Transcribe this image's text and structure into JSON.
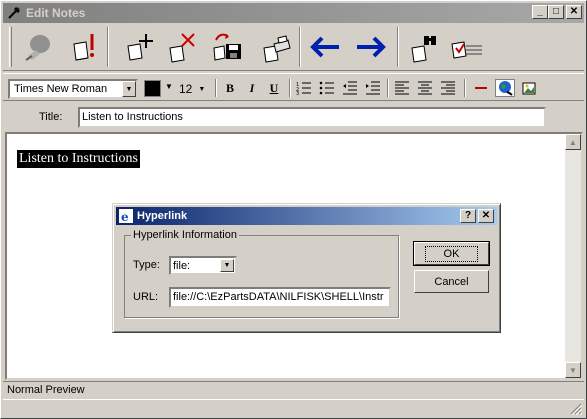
{
  "window": {
    "title": "Edit Notes"
  },
  "toolbar": {
    "icons": [
      "disconnect-icon",
      "alert-note-icon",
      "new-note-icon",
      "delete-note-icon",
      "save-icon",
      "print-icon",
      "back-arrow-icon",
      "forward-arrow-icon",
      "find-icon",
      "checklist-icon"
    ]
  },
  "format": {
    "font": "Times New Roman",
    "size": "12",
    "bold": "B",
    "italic": "I",
    "underline": "U",
    "color": "#000000"
  },
  "title_field": {
    "label": "Title:",
    "value": "Listen to Instructions"
  },
  "editor": {
    "content": "Listen to Instructions"
  },
  "status": {
    "mode": "Normal Preview"
  },
  "dialog": {
    "title": "Hyperlink",
    "group_label": "Hyperlink Information",
    "type_label": "Type:",
    "type_value": "file:",
    "url_label": "URL:",
    "url_value": "file://C:\\EzPartsDATA\\NILFISK\\SHELL\\Instr",
    "ok_label": "OK",
    "cancel_label": "Cancel"
  },
  "colors": {
    "title_inactive": "#808080",
    "dialog_title": "#0a246a",
    "arrow_blue": "#0020b0"
  }
}
